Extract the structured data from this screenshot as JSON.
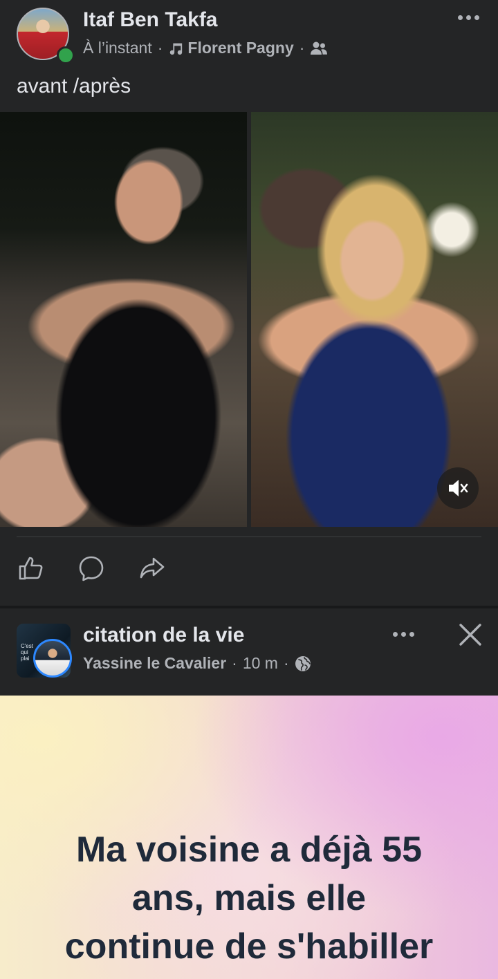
{
  "post1": {
    "author": "Itaf Ben Takfa",
    "time": "À l’instant",
    "song": "Florent Pagny",
    "separator": "·",
    "text": "avant /après",
    "icons": [
      "music-note-icon",
      "friends-icon",
      "more-icon",
      "mute-icon",
      "like-icon",
      "comment-icon",
      "share-icon"
    ]
  },
  "post2": {
    "page_name": "citation de la vie",
    "poster": "Yassine le Cavalier",
    "time": "10 m",
    "separator": "·",
    "avatar_caption": [
      "C'est",
      "qui",
      "plai"
    ],
    "quote_lines": [
      "Ma voisine a déjà 55",
      "ans, mais elle",
      "continue de s'habiller"
    ],
    "icons": [
      "globe-icon",
      "more-icon",
      "close-icon"
    ]
  },
  "colors": {
    "background": "#18191a",
    "card": "#242526",
    "primary_text": "#e4e6eb",
    "secondary_text": "#b0b3b8",
    "online": "#31a24c",
    "story_ring": "#2d88ff"
  }
}
